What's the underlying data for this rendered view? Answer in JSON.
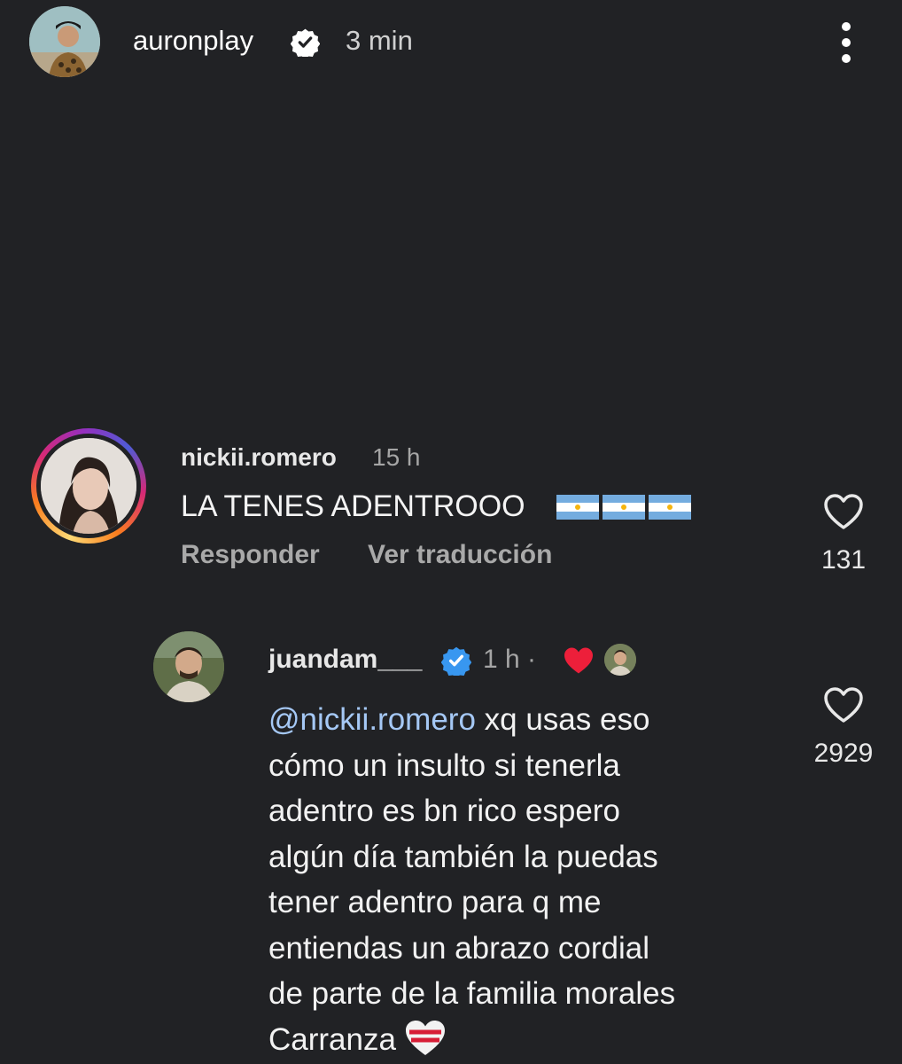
{
  "story_header": {
    "username": "auronplay",
    "time": "3 min",
    "avatar_icon": "story-avatar-photo",
    "verified_icon": "verified-badge-icon",
    "menu_icon": "more-vertical-icon"
  },
  "comments": [
    {
      "username": "nickii.romero",
      "time": "15 h",
      "text": "LA TENES ADENTROOO",
      "emoji": [
        "flag-argentina",
        "flag-argentina",
        "flag-argentina"
      ],
      "actions": {
        "reply": "Responder",
        "translate": "Ver traducción"
      },
      "likes": "131",
      "has_story_ring": true
    },
    {
      "username": "juandam___",
      "verified": true,
      "time": "1 h ·",
      "liked_by_author": true,
      "mention": "@nickii.romero",
      "text": " xq usas eso\ncómo un insulto si tenerla\nadentro es bn rico espero\nalgún día también la puedas\ntener adentro para q me\nentiendas un abrazo cordial\nde parte de la familia morales\nCarranza",
      "trailing_emoji": "heart-white-red",
      "likes": "2929"
    }
  ],
  "colors": {
    "background": "#212225",
    "mention": "#a5c8f5",
    "verified_blue": "#3897f0",
    "like_red": "#ed1f3a"
  }
}
